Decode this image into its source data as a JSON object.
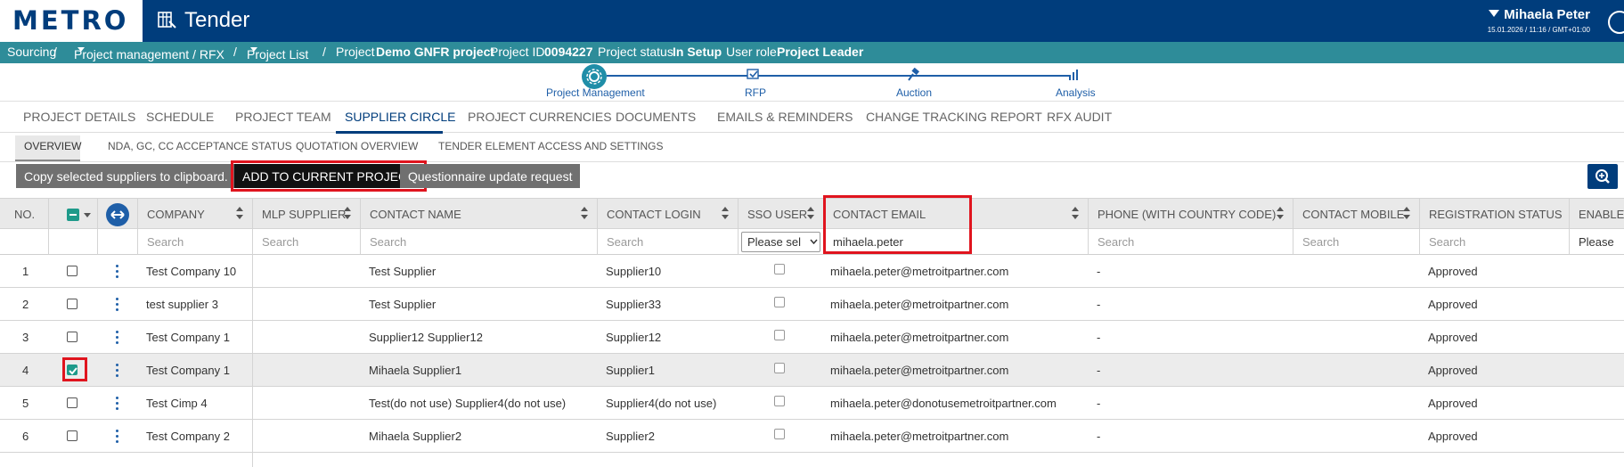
{
  "header": {
    "logo": "METRO",
    "app_title": "Tender",
    "user_name": "Mihaela Peter",
    "datetime": "15.01.2026 / 11:16 / GMT+01:00"
  },
  "breadcrumb": {
    "sourcing": "Sourcing",
    "sep": "/",
    "project_mgmt": "Project management / RFX",
    "project_list": "Project List",
    "project_label": "Project",
    "project_name": "Demo GNFR project",
    "project_id_label": "Project ID",
    "project_id": "0094227",
    "status_label": "Project status",
    "status": "In Setup",
    "role_label": "User role",
    "role": "Project Leader"
  },
  "steps": [
    "Project Management",
    "RFP",
    "Auction",
    "Analysis"
  ],
  "tabs": [
    "PROJECT DETAILS",
    "SCHEDULE",
    "PROJECT TEAM",
    "SUPPLIER CIRCLE",
    "PROJECT CURRENCIES",
    "DOCUMENTS",
    "EMAILS & REMINDERS",
    "CHANGE TRACKING REPORT",
    "RFX AUDIT"
  ],
  "subtabs": [
    "OVERVIEW",
    "NDA, GC, CC ACCEPTANCE STATUS",
    "QUOTATION OVERVIEW",
    "TENDER ELEMENT ACCESS AND SETTINGS"
  ],
  "toolbar": {
    "copy": "Copy selected suppliers to clipboard.",
    "add": "ADD TO CURRENT PROJECT",
    "questionnaire": "Questionnaire update request"
  },
  "columns": {
    "no": "NO.",
    "company": "COMPANY",
    "mlp": "MLP SUPPLIER",
    "contact_name": "CONTACT NAME",
    "contact_login": "CONTACT LOGIN",
    "sso": "SSO USER",
    "email": "CONTACT EMAIL",
    "phone": "PHONE (WITH COUNTRY CODE)",
    "mobile": "CONTACT MOBILE",
    "reg_status": "REGISTRATION STATUS",
    "enable": "ENABLE"
  },
  "filters": {
    "search": "Search",
    "please_select": "Please sel",
    "please_select_2": "Please",
    "email_value": "mihaela.peter"
  },
  "rows": [
    {
      "no": "1",
      "company": "Test Company 10",
      "contact": "Test Supplier",
      "login": "Supplier10",
      "email": "mihaela.peter@metroitpartner.com",
      "phone": "-",
      "status": "Approved",
      "checked": false
    },
    {
      "no": "2",
      "company": "test supplier 3",
      "contact": "Test Supplier",
      "login": "Supplier33",
      "email": "mihaela.peter@metroitpartner.com",
      "phone": "-",
      "status": "Approved",
      "checked": false
    },
    {
      "no": "3",
      "company": "Test Company 1",
      "contact": "Supplier12 Supplier12",
      "login": "Supplier12",
      "email": "mihaela.peter@metroitpartner.com",
      "phone": "-",
      "status": "Approved",
      "checked": false
    },
    {
      "no": "4",
      "company": "Test Company 1",
      "contact": "Mihaela Supplier1",
      "login": "Supplier1",
      "email": "mihaela.peter@metroitpartner.com",
      "phone": "-",
      "status": "Approved",
      "checked": true
    },
    {
      "no": "5",
      "company": "Test Cimp 4",
      "contact": "Test(do not use) Supplier4(do not use)",
      "login": "Supplier4(do not use)",
      "email": "mihaela.peter@donotusemetroitpartner.com",
      "phone": "-",
      "status": "Approved",
      "checked": false
    },
    {
      "no": "6",
      "company": "Test Company 2",
      "contact": "Mihaela Supplier2",
      "login": "Supplier2",
      "email": "mihaela.peter@metroitpartner.com",
      "phone": "-",
      "status": "Approved",
      "checked": false
    }
  ],
  "colors": {
    "brand": "#003d7c",
    "teal": "#2e8c99",
    "highlight": "#e0141e",
    "check": "#1e9a8a"
  }
}
